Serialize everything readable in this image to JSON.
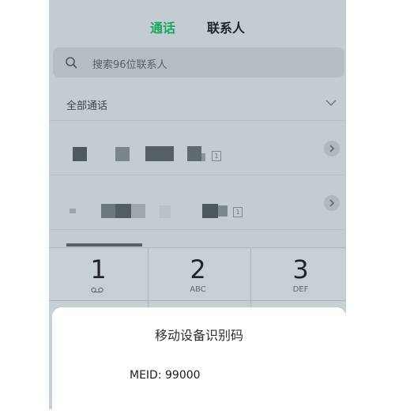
{
  "tabs": [
    {
      "label": "通话",
      "active": true
    },
    {
      "label": "联系人",
      "active": false
    }
  ],
  "search": {
    "placeholder": "搜索96位联系人"
  },
  "section": {
    "label": "全部通话"
  },
  "call_rows": [
    {
      "badge": "1"
    },
    {
      "badge": "1"
    }
  ],
  "keypad": {
    "keys": [
      {
        "digit": "1",
        "sub": "voicemail-icon"
      },
      {
        "digit": "2",
        "sub": "ABC"
      },
      {
        "digit": "3",
        "sub": "DEF"
      }
    ]
  },
  "dialog": {
    "title": "移动设备识别码",
    "meid": "MEID: 99000"
  },
  "colors": {
    "accent": "#1aa85f",
    "overlay": "#c3ccd1"
  }
}
